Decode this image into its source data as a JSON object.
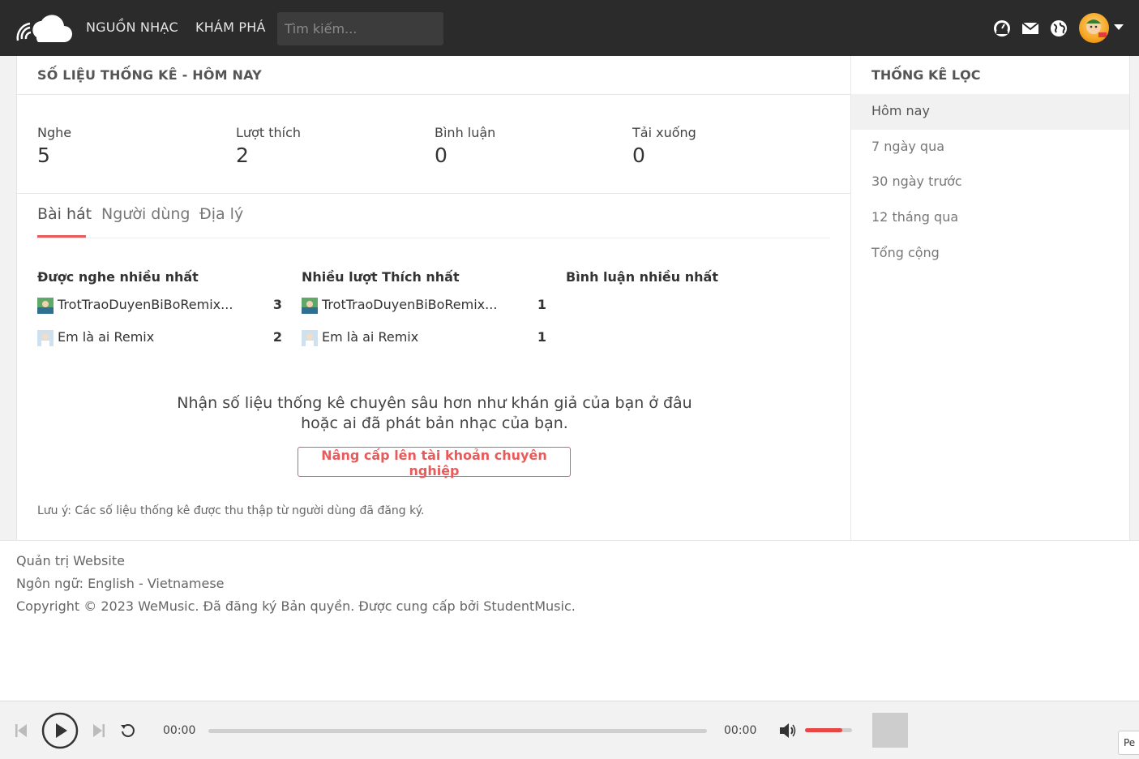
{
  "header": {
    "nav": [
      "NGUỒN NHẠC",
      "KHÁM PHÁ"
    ],
    "search_placeholder": "Tìm kiếm..."
  },
  "main": {
    "title": "SỐ LIỆU THỐNG KÊ - HÔM NAY",
    "stats": [
      {
        "label": "Nghe",
        "value": "5"
      },
      {
        "label": "Lượt thích",
        "value": "2"
      },
      {
        "label": "Bình luận",
        "value": "0"
      },
      {
        "label": "Tải xuống",
        "value": "0"
      }
    ],
    "tabs": [
      "Bài hát",
      "Người dùng",
      "Địa lý"
    ],
    "columns": [
      {
        "title": "Được nghe nhiều nhất",
        "rows": [
          {
            "name": "TrotTraoDuyenBiBoRemix...",
            "count": "3"
          },
          {
            "name": "Em là ai Remix",
            "count": "2"
          }
        ]
      },
      {
        "title": "Nhiều lượt Thích nhất",
        "rows": [
          {
            "name": "TrotTraoDuyenBiBoRemix...",
            "count": "1"
          },
          {
            "name": "Em là ai Remix",
            "count": "1"
          }
        ]
      },
      {
        "title": "Bình luận nhiều nhất",
        "rows": []
      }
    ],
    "promo_line1": "Nhận số liệu thống kê chuyên sâu hơn như khán giả của bạn ở đâu",
    "promo_line2": "hoặc ai đã phát bản nhạc của bạn.",
    "upgrade_button": "Nâng cấp lên tài khoản chuyên nghiệp",
    "note": "Lưu ý: Các số liệu thống kê được thu thập từ người dùng đã đăng ký."
  },
  "sidebar": {
    "title": "THỐNG KÊ LỌC",
    "items": [
      "Hôm nay",
      "7 ngày qua",
      "30 ngày trước",
      "12 tháng qua",
      "Tổng cộng"
    ],
    "active_index": 0
  },
  "footer": {
    "admin_link": "Quản trị Website",
    "language_label": "Ngôn ngữ:",
    "language_en": "English",
    "language_sep": "-",
    "language_vi": "Vietnamese",
    "copyright": "Copyright © 2023 WeMusic. Đã đăng ký Bản quyền. Được cung cấp bởi StudentMusic."
  },
  "player": {
    "time_current": "00:00",
    "time_total": "00:00",
    "progress_fraction": 0,
    "volume_fraction": 0.8,
    "corner_label": "Pe"
  },
  "colors": {
    "accent": "#e85b5b",
    "topbar": "#2b2b2b"
  },
  "icons": [
    "cloud-logo-icon",
    "dashboard-icon",
    "mail-icon",
    "globe-icon",
    "caret-down-icon",
    "skip-previous-icon",
    "play-icon",
    "skip-next-icon",
    "repeat-icon",
    "volume-icon"
  ]
}
